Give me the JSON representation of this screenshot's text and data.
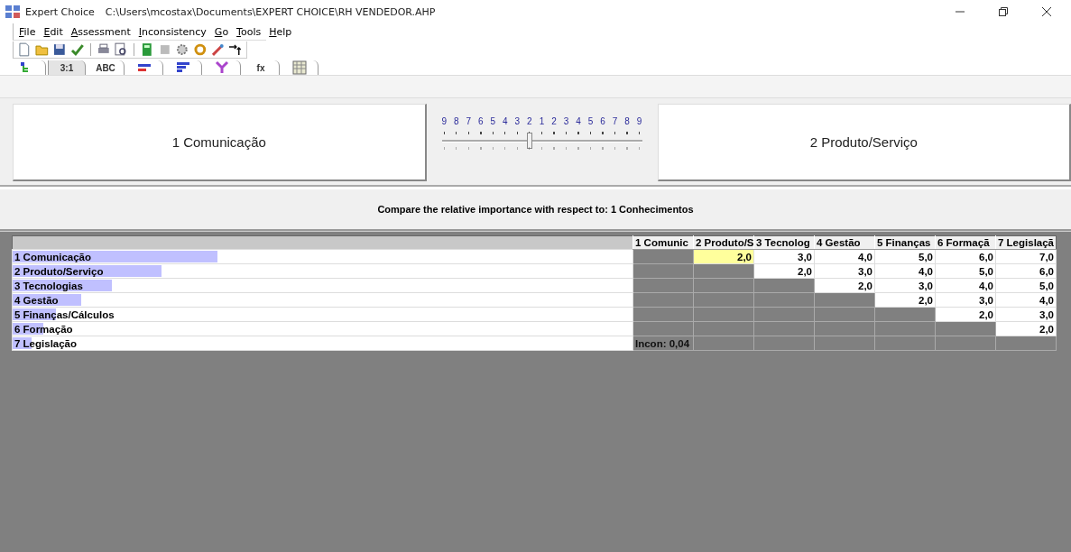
{
  "window": {
    "app": "Expert Choice",
    "path": "C:\\Users\\mcostax\\Documents\\EXPERT CHOICE\\RH VENDEDOR.AHP"
  },
  "menu": [
    "File",
    "Edit",
    "Assessment",
    "Inconsistency",
    "Go",
    "Tools",
    "Help"
  ],
  "toolbar": [
    {
      "kind": "new"
    },
    {
      "kind": "open"
    },
    {
      "kind": "save"
    },
    {
      "kind": "check"
    },
    {
      "kind": "sep"
    },
    {
      "kind": "print"
    },
    {
      "kind": "preview"
    },
    {
      "kind": "sep"
    },
    {
      "kind": "calc"
    },
    {
      "kind": "grey"
    },
    {
      "kind": "gear"
    },
    {
      "kind": "refresh"
    },
    {
      "kind": "wand"
    },
    {
      "kind": "arrow"
    }
  ],
  "tabs": [
    {
      "kind": "tree",
      "selected": false
    },
    {
      "kind": "text",
      "label": "3:1",
      "selected": true
    },
    {
      "kind": "text",
      "label": "ABC",
      "selected": false
    },
    {
      "kind": "bars",
      "selected": false
    },
    {
      "kind": "hbars",
      "selected": false
    },
    {
      "kind": "sens",
      "selected": false
    },
    {
      "kind": "text",
      "label": "fx",
      "selected": false
    },
    {
      "kind": "grid",
      "selected": false
    }
  ],
  "compare": {
    "left": "1 Comunicação",
    "right": "2 Produto/Serviço",
    "scale": [
      "9",
      "8",
      "7",
      "6",
      "5",
      "4",
      "3",
      "2",
      "1",
      "2",
      "3",
      "4",
      "5",
      "6",
      "7",
      "8",
      "9"
    ],
    "level": 0.4375
  },
  "question": "Compare the relative importance with respect to: 1 Conhecimentos",
  "matrix": {
    "columns": [
      "1 Comunic",
      "2 Produto/S",
      "3 Tecnolog",
      "4 Gestão",
      "5 Finanças",
      "6 Formaçã",
      "7 Legislaçã"
    ],
    "rows": [
      {
        "label": "1 Comunicação",
        "level": 0.33,
        "cells": [
          {
            "kind": "blank"
          },
          {
            "kind": "value",
            "text": "2,0",
            "selected": true
          },
          {
            "kind": "value",
            "text": "3,0",
            "selected": false
          },
          {
            "kind": "value",
            "text": "4,0",
            "selected": false
          },
          {
            "kind": "value",
            "text": "5,0",
            "selected": false
          },
          {
            "kind": "value",
            "text": "6,0",
            "selected": false
          },
          {
            "kind": "value",
            "text": "7,0",
            "selected": false
          }
        ]
      },
      {
        "label": "2 Produto/Serviço",
        "level": 0.24,
        "cells": [
          {
            "kind": "blank"
          },
          {
            "kind": "blank"
          },
          {
            "kind": "value",
            "text": "2,0",
            "selected": false
          },
          {
            "kind": "value",
            "text": "3,0",
            "selected": false
          },
          {
            "kind": "value",
            "text": "4,0",
            "selected": false
          },
          {
            "kind": "value",
            "text": "5,0",
            "selected": false
          },
          {
            "kind": "value",
            "text": "6,0",
            "selected": false
          }
        ]
      },
      {
        "label": "3 Tecnologias",
        "level": 0.16,
        "cells": [
          {
            "kind": "blank"
          },
          {
            "kind": "blank"
          },
          {
            "kind": "blank"
          },
          {
            "kind": "value",
            "text": "2,0",
            "selected": false
          },
          {
            "kind": "value",
            "text": "3,0",
            "selected": false
          },
          {
            "kind": "value",
            "text": "4,0",
            "selected": false
          },
          {
            "kind": "value",
            "text": "5,0",
            "selected": false
          }
        ]
      },
      {
        "label": "4 Gestão",
        "level": 0.11,
        "cells": [
          {
            "kind": "blank"
          },
          {
            "kind": "blank"
          },
          {
            "kind": "blank"
          },
          {
            "kind": "blank"
          },
          {
            "kind": "value",
            "text": "2,0",
            "selected": false
          },
          {
            "kind": "value",
            "text": "3,0",
            "selected": false
          },
          {
            "kind": "value",
            "text": "4,0",
            "selected": false
          }
        ]
      },
      {
        "label": "5 Finanças/Cálculos",
        "level": 0.07,
        "cells": [
          {
            "kind": "blank"
          },
          {
            "kind": "blank"
          },
          {
            "kind": "blank"
          },
          {
            "kind": "blank"
          },
          {
            "kind": "blank"
          },
          {
            "kind": "value",
            "text": "2,0",
            "selected": false
          },
          {
            "kind": "value",
            "text": "3,0",
            "selected": false
          }
        ]
      },
      {
        "label": "6 Formação",
        "level": 0.05,
        "cells": [
          {
            "kind": "blank"
          },
          {
            "kind": "blank"
          },
          {
            "kind": "blank"
          },
          {
            "kind": "blank"
          },
          {
            "kind": "blank"
          },
          {
            "kind": "blank"
          },
          {
            "kind": "value",
            "text": "2,0",
            "selected": false
          }
        ]
      },
      {
        "label": "7 Legislação",
        "level": 0.03,
        "cells": [
          {
            "kind": "incon",
            "text": "Incon: 0,04"
          },
          {
            "kind": "blank"
          },
          {
            "kind": "blank"
          },
          {
            "kind": "blank"
          },
          {
            "kind": "blank"
          },
          {
            "kind": "blank"
          },
          {
            "kind": "blank"
          }
        ]
      }
    ]
  }
}
